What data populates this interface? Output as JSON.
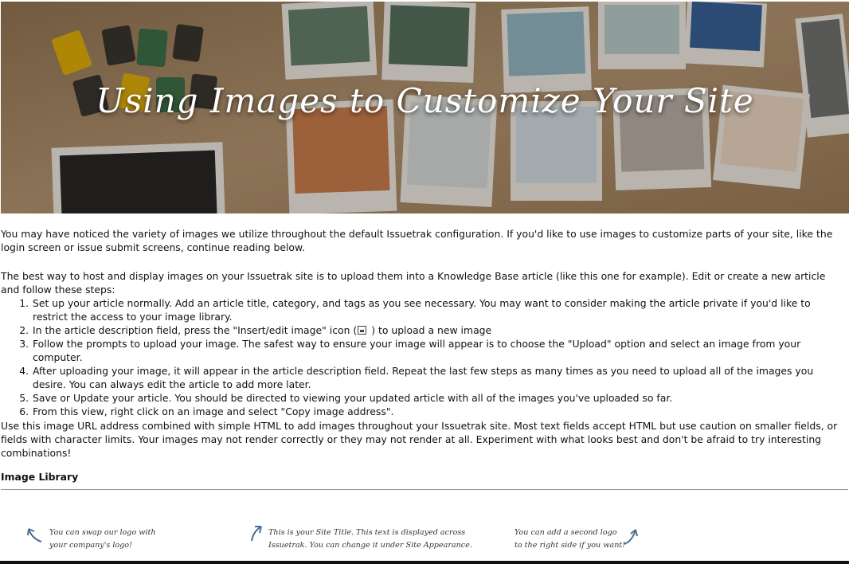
{
  "hero": {
    "title": "Using Images to Customize Your Site"
  },
  "article": {
    "intro": "You may have noticed the variety of images we utilize throughout the default Issuetrak configuration. If you'd like to use images to customize parts of your site, like the login screen or issue submit screens, continue reading below.",
    "steps_intro": "The best way to host and display images on your Issuetrak site is to upload them into a Knowledge Base article (like this one for example). Edit or create a new article and follow these steps:",
    "steps": [
      "Set up your article normally. Add an article title, category, and tags as you see necessary. You may want to consider making the article private if you'd like to restrict the access to your image library.",
      {
        "before_icon": "In the article description field, press the \"Insert/edit image\" icon (",
        "icon": "image-icon",
        "after_icon": ") to upload a new image"
      },
      "Follow the prompts to upload your image. The safest way to ensure your image will appear is to choose the \"Upload\" option and select an image from your computer.",
      "After uploading your image, it will appear in the article description field. Repeat the last few steps as many times as you need to upload all of the images you desire. You can always edit the article to add more later.",
      "Save or Update your article. You should be directed to viewing your updated article with all of the images you've uploaded so far.",
      "From this view, right click on an image and select \"Copy image address\"."
    ],
    "outro": "Use this image URL address combined with simple HTML to add images throughout your Issuetrak site. Most text fields accept HTML but use caution on smaller fields, or fields with character limits. Your images may not render correctly or they may not render at all. Experiment with what looks best and don't be afraid to try interesting combinations!"
  },
  "library": {
    "heading": "Image Library",
    "notes": [
      {
        "lines": [
          "You can swap our logo with",
          "your company's logo!"
        ],
        "arrow_icon": "arrow-up-left-icon"
      },
      {
        "lines": [
          "This is your Site Title. This text is displayed across",
          "Issuetrak. You can change it under Site Appearance."
        ],
        "arrow_icon": "arrow-up-right-icon"
      },
      {
        "lines": [
          "You can add a second logo",
          "to the right side if you want!"
        ],
        "arrow_icon": "arrow-up-right-icon"
      }
    ]
  },
  "colors": {
    "hero_overlay": "#a88a66",
    "text": "#111111",
    "rule": "#999999",
    "arrow": "#4a6f94"
  }
}
